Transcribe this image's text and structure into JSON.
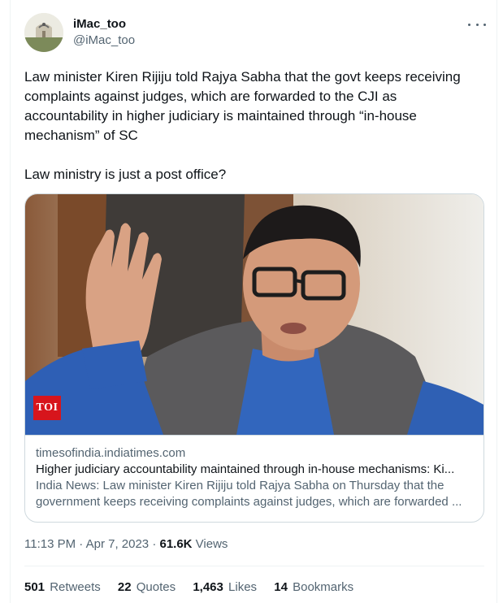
{
  "author": {
    "display_name": "iMac_too",
    "handle": "@iMac_too"
  },
  "tweet": {
    "text": "Law minister Kiren Rijiju told Rajya Sabha that the govt keeps receiving complaints against judges, which are forwarded to the CJI as accountability in higher judiciary is maintained through “in-house mechanism” of SC",
    "text2": "Law ministry is just a post office?"
  },
  "card": {
    "badge": "TOI",
    "domain": "timesofindia.indiatimes.com",
    "title": "Higher judiciary accountability maintained through in-house mechanisms: Ki...",
    "description": "India News: Law minister Kiren Rijiju told Rajya Sabha on Thursday that the government keeps receiving complaints against judges, which are forwarded ..."
  },
  "meta": {
    "time_date": "11:13 PM · Apr 7, 2023 · ",
    "views_count": "61.6K",
    "views_label": " Views"
  },
  "stats": [
    {
      "count": "501",
      "label": "Retweets"
    },
    {
      "count": "22",
      "label": "Quotes"
    },
    {
      "count": "1,463",
      "label": "Likes"
    },
    {
      "count": "14",
      "label": "Bookmarks"
    }
  ],
  "icons": {
    "more": "more-horizontal-icon"
  },
  "colors": {
    "text": "#0f1419",
    "secondary": "#536471",
    "border": "#cfd9de",
    "toi_red": "#d7151c"
  }
}
